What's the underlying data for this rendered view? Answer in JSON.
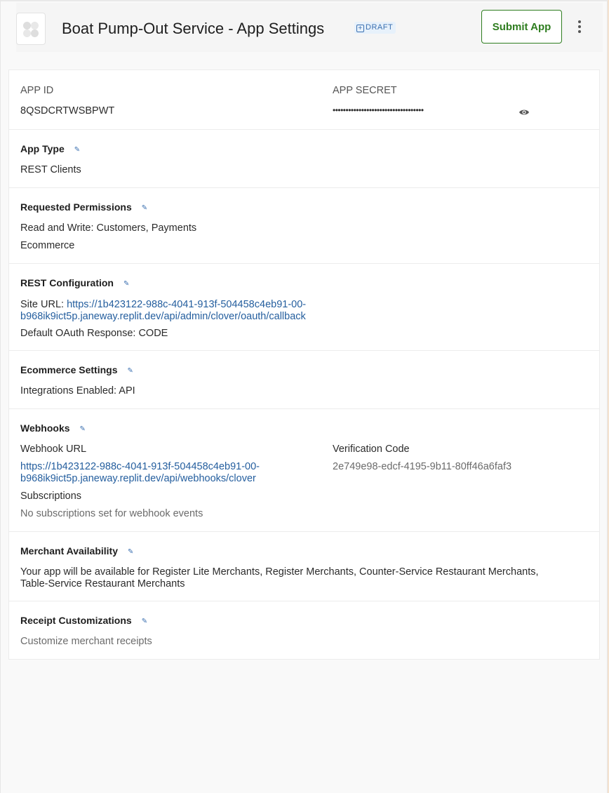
{
  "header": {
    "title": "Boat Pump-Out Service - App Settings",
    "badge": "DRAFT",
    "submit_label": "Submit App",
    "logo_icon": "app-placeholder-icon",
    "more_icon": "vertical-ellipsis-icon"
  },
  "credentials": {
    "app_id_label": "APP ID",
    "app_id_value": "8QSDCRTWSBPWT",
    "app_secret_label": "APP SECRET",
    "app_secret_value": "•••••••••••••••••••••••••••••••••••",
    "reveal_icon": "eye-icon"
  },
  "app_type": {
    "title": "App Type",
    "value": "REST Clients"
  },
  "permissions": {
    "title": "Requested Permissions",
    "line1": "Read and Write: Customers, Payments",
    "line2": "Ecommerce"
  },
  "rest_config": {
    "title": "REST Configuration",
    "site_url_label": "Site URL: ",
    "site_url_line1": "https://1b423122-988c-4041-913f-504458c4eb91-00-",
    "site_url_line2": "b968ik9ict5p.janeway.replit.dev/api/admin/clover/oauth/callback",
    "oauth_response": "Default OAuth Response: CODE"
  },
  "ecommerce": {
    "title": "Ecommerce Settings",
    "value": "Integrations Enabled: API"
  },
  "webhooks": {
    "title": "Webhooks",
    "url_label": "Webhook URL",
    "url_line1": "https://1b423122-988c-4041-913f-504458c4eb91-00-",
    "url_line2": "b968ik9ict5p.janeway.replit.dev/api/webhooks/clover",
    "verification_label": "Verification Code",
    "verification_value": "2e749e98-edcf-4195-9b11-80ff46a6faf3",
    "subscriptions_label": "Subscriptions",
    "subscriptions_value": "No subscriptions set for webhook events"
  },
  "merchant_availability": {
    "title": "Merchant Availability",
    "line1": "Your app will be available for Register Lite Merchants, Register Merchants, Counter-Service Restaurant Merchants,",
    "line2": "Table-Service Restaurant Merchants"
  },
  "receipt": {
    "title": "Receipt Customizations",
    "value": "Customize merchant receipts"
  },
  "edit_icon": "pencil-icon",
  "colors": {
    "accent_green": "#2e7d1f",
    "link_blue": "#245e9e",
    "badge_bg": "#e7f1fb"
  }
}
